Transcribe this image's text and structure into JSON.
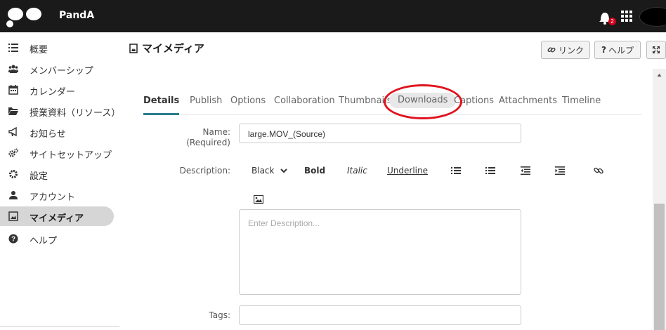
{
  "brand": {
    "name": "PandA"
  },
  "notifications": {
    "count": "2"
  },
  "sidebar": {
    "items": [
      {
        "label": "概要",
        "icon": "list-icon"
      },
      {
        "label": "メンバーシップ",
        "icon": "users-icon"
      },
      {
        "label": "カレンダー",
        "icon": "calendar-icon"
      },
      {
        "label": "授業資料（リソース）",
        "icon": "folder-icon"
      },
      {
        "label": "お知らせ",
        "icon": "bullhorn-icon"
      },
      {
        "label": "サイトセットアップ",
        "icon": "gears-icon"
      },
      {
        "label": "設定",
        "icon": "gear-icon"
      },
      {
        "label": "アカウント",
        "icon": "user-icon"
      },
      {
        "label": "マイメディア",
        "icon": "media-icon",
        "active": true
      },
      {
        "label": "ヘルプ",
        "icon": "question-icon"
      }
    ]
  },
  "header": {
    "title": "マイメディア",
    "link_label": "リンク",
    "help_label": "ヘルプ",
    "help_glyph": "?"
  },
  "tabs": [
    {
      "label": "Details",
      "active": true
    },
    {
      "label": "Publish"
    },
    {
      "label": "Options"
    },
    {
      "label": "Collaboration"
    },
    {
      "label": "Thumbnails"
    },
    {
      "label": "Downloads",
      "highlighted": true
    },
    {
      "label": "Captions"
    },
    {
      "label": "Attachments"
    },
    {
      "label": "Timeline"
    }
  ],
  "form": {
    "name_label": "Name:",
    "name_required": "(Required)",
    "name_value": "large.MOV_(Source)",
    "description_label": "Description:",
    "toolbar": {
      "color": "Black",
      "bold": "Bold",
      "italic": "Italic",
      "underline": "Underline"
    },
    "description_placeholder": "Enter Description...",
    "tags_label": "Tags:"
  },
  "colors": {
    "topbar": "#1a1a1a",
    "accent": "#2a7d8c",
    "highlight_circle": "#e0141e"
  }
}
